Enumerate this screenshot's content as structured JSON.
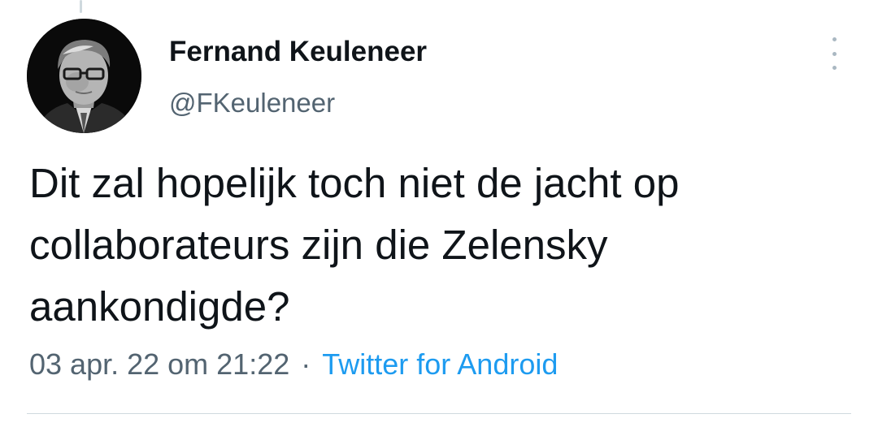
{
  "tweet": {
    "author": {
      "display_name": "Fernand Keuleneer",
      "handle": "@FKeuleneer",
      "avatar_icon": "profile-photo"
    },
    "text_lines": [
      "Dit zal hopelijk toch niet de jacht op",
      "collaborateurs zijn die Zelensky",
      "aankondigde?"
    ],
    "timestamp": "03 apr. 22 om 21:22",
    "separator": "·",
    "source": "Twitter for Android",
    "more_icon": "more-vertical-icon"
  },
  "colors": {
    "text": "#0f1419",
    "secondary_text": "#536471",
    "link": "#1d9bf0",
    "divider": "#cfd9de",
    "more_dots": "#aab8c2"
  }
}
